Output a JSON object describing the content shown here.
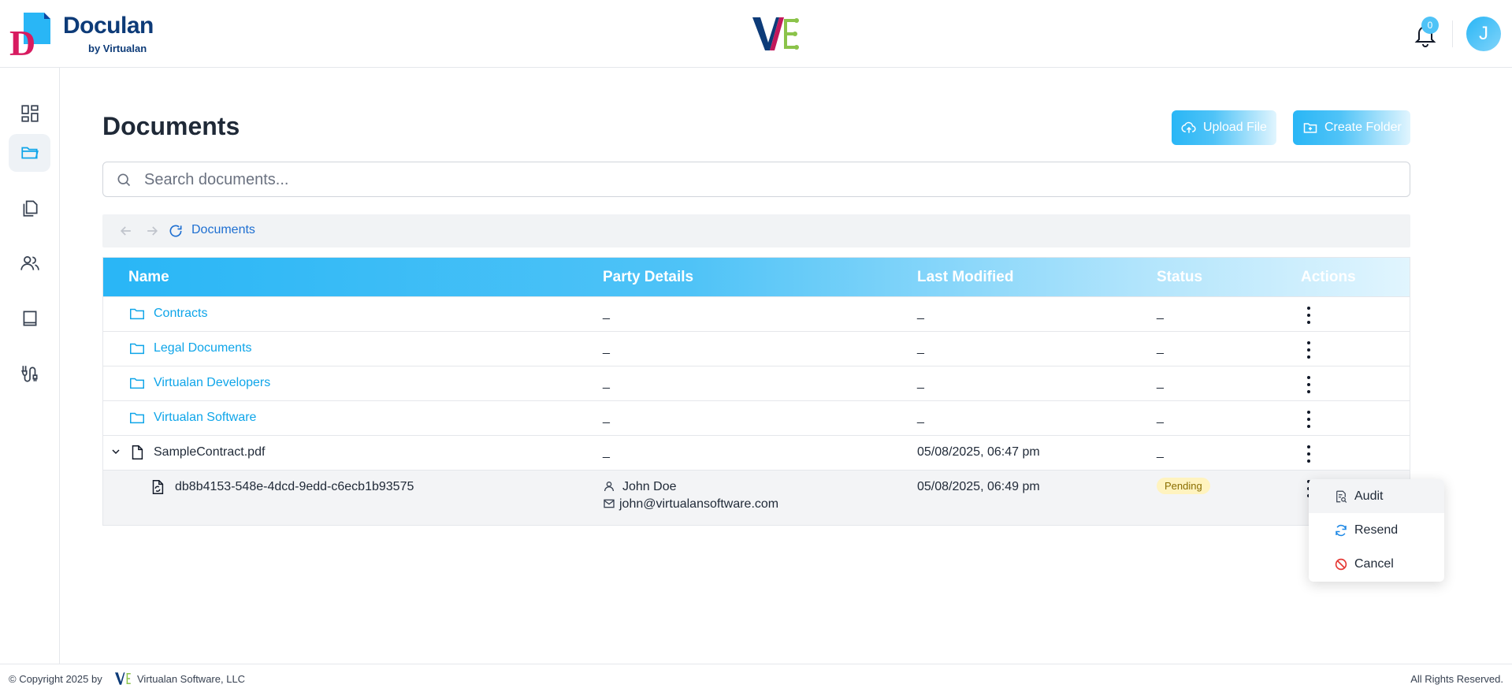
{
  "app": {
    "name": "Doculan",
    "byline": "by Virtualan",
    "notification_count": "0",
    "avatar_initial": "J"
  },
  "sidebar": {
    "items": [
      {
        "icon": "dashboard-icon"
      },
      {
        "icon": "folder-icon",
        "active": true
      },
      {
        "icon": "copy-documents-icon"
      },
      {
        "icon": "users-icon"
      },
      {
        "icon": "book-icon"
      },
      {
        "icon": "workflow-icon"
      }
    ]
  },
  "main": {
    "title": "Documents",
    "upload_label": "Upload File",
    "create_folder_label": "Create Folder",
    "search_placeholder": "Search documents...",
    "breadcrumb": "Documents"
  },
  "table": {
    "headers": [
      "Name",
      "Party Details",
      "Last Modified",
      "Status",
      "Actions"
    ],
    "rows": [
      {
        "type": "folder",
        "name": "Contracts",
        "party": "_",
        "modified": "_",
        "status": "_"
      },
      {
        "type": "folder",
        "name": "Legal Documents",
        "party": "_",
        "modified": "_",
        "status": "_"
      },
      {
        "type": "folder",
        "name": "Virtualan Developers",
        "party": "_",
        "modified": "_",
        "status": "_"
      },
      {
        "type": "folder",
        "name": "Virtualan Software",
        "party": "_",
        "modified": "_",
        "status": "_"
      },
      {
        "type": "file",
        "name": "SampleContract.pdf",
        "party": "_",
        "modified": "05/08/2025, 06:47 pm",
        "status": "_"
      }
    ],
    "subrow": {
      "id": "db8b4153-548e-4dcd-9edd-c6ecb1b93575",
      "party_name": "John Doe",
      "party_email": "john@virtualansoftware.com",
      "modified": "05/08/2025, 06:49 pm",
      "status": "Pending"
    }
  },
  "context_menu": {
    "items": [
      "Audit",
      "Resend",
      "Cancel"
    ]
  },
  "footer": {
    "copyright": "© Copyright 2025 by",
    "company": "Virtualan Software, LLC",
    "rights": "All Rights Reserved."
  },
  "colors": {
    "accent": "#29b6f6",
    "brand_navy": "#0d3b78",
    "folder_link": "#0ea5e9",
    "pending_bg": "#fff3bf"
  }
}
